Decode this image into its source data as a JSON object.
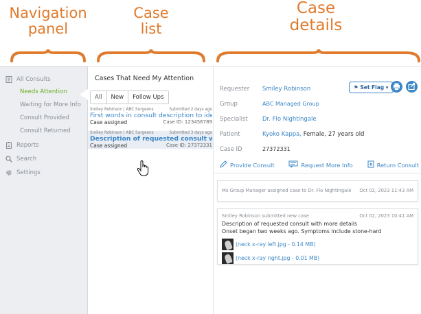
{
  "annotations": {
    "nav_line1": "Navigation",
    "nav_line2": "panel",
    "list_line1": "Case",
    "list_line2": "list",
    "details_line1": "Case",
    "details_line2": "details",
    "color": "#e07a2c"
  },
  "nav": {
    "items": [
      {
        "label": "All Consults",
        "icon": "document-icon"
      },
      {
        "label": "Reports",
        "icon": "clipboard-icon"
      },
      {
        "label": "Search",
        "icon": "search-icon"
      },
      {
        "label": "Settings",
        "icon": "gear-icon"
      }
    ],
    "sub_items": [
      {
        "label": "Needs Attention",
        "active": true
      },
      {
        "label": "Waiting for More Info",
        "active": false
      },
      {
        "label": "Consult Provided",
        "active": false
      },
      {
        "label": "Consult Returned",
        "active": false
      }
    ],
    "active_color": "#6cae23"
  },
  "case_list": {
    "title": "Cases That Need My Attention",
    "tabs": [
      "All",
      "New",
      "Follow Ups"
    ],
    "cases": [
      {
        "meta_left": "Smiley Robinson | ABC Surgeons",
        "meta_right": "Submitted 2 days ago",
        "description": "First words in consult description to identify",
        "status": "Case assigned",
        "case_id": "Case ID: 123456789",
        "selected": false
      },
      {
        "meta_left": "Smiley Robinson | ABC Surgeons",
        "meta_right": "Submitted 3 days ago",
        "description": "Description of requested consult with more",
        "status": "Case assigned",
        "case_id": "Case ID: 27372331",
        "selected": true
      }
    ]
  },
  "details": {
    "set_flag_label": "Set Flag",
    "fields": [
      {
        "label": "Requester",
        "value": "Smiley Robinson",
        "link": true
      },
      {
        "label": "Group",
        "value": "ABC Managed Group",
        "link": true
      },
      {
        "label": "Specialist",
        "value": "Dr. Flo Nightingale",
        "link": true
      },
      {
        "label": "Patient",
        "value": "Kyoko Kappa,",
        "extra": " Female, 27 years old",
        "link": true
      },
      {
        "label": "Case ID",
        "value": "27372331",
        "link": false
      }
    ],
    "actions": [
      {
        "label": "Provide Consult",
        "icon": "pen-icon"
      },
      {
        "label": "Request More Info",
        "icon": "chat-icon"
      },
      {
        "label": "Return Consult",
        "icon": "return-icon"
      }
    ],
    "events": [
      {
        "text": "Ms Group Manager assigned case to Dr. Flo Nightingale",
        "date": "Oct 02, 2023 11:43 AM"
      },
      {
        "text": "Smiley Robinson submitted new case",
        "date": "Oct 02, 2023 10:41 AM",
        "body_line1": "Description of requested consult with more details",
        "body_line2": "Onset began two weeks ago. Symptoms include stone-hard",
        "attachments": [
          "(neck x-ray left.jpg - 0.14 MB)",
          "(neck x-ray right.jpg - 0.01 MB)"
        ]
      }
    ],
    "link_color": "#3b86c6"
  }
}
